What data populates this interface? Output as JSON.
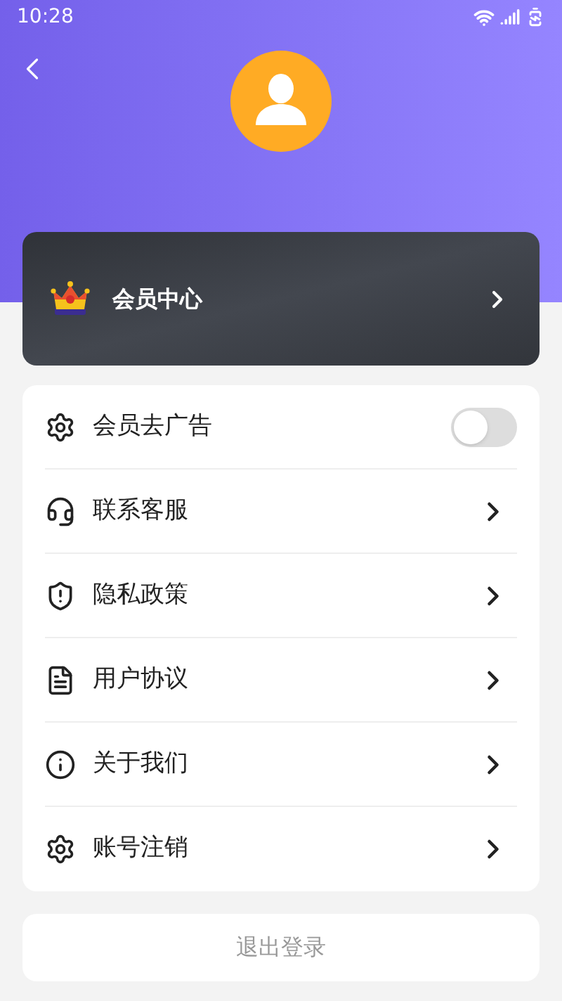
{
  "status_bar": {
    "time": "10:28"
  },
  "member_card": {
    "title": "会员中心"
  },
  "settings": [
    {
      "kind": "toggle",
      "label": "会员去广告",
      "on": false
    },
    {
      "kind": "link",
      "label": "联系客服"
    },
    {
      "kind": "link",
      "label": "隐私政策"
    },
    {
      "kind": "link",
      "label": "用户协议"
    },
    {
      "kind": "link",
      "label": "关于我们"
    },
    {
      "kind": "link",
      "label": "账号注销"
    }
  ],
  "logout_button": {
    "label": "退出登录"
  }
}
